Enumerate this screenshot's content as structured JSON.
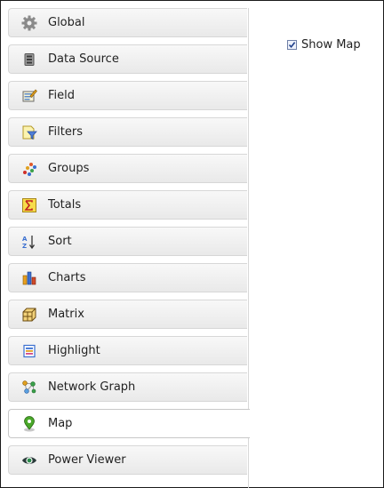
{
  "nav": {
    "items": [
      {
        "label": "Global",
        "icon": "gear-icon"
      },
      {
        "label": "Data Source",
        "icon": "database-icon"
      },
      {
        "label": "Field",
        "icon": "field-edit-icon"
      },
      {
        "label": "Filters",
        "icon": "filter-icon"
      },
      {
        "label": "Groups",
        "icon": "groups-icon"
      },
      {
        "label": "Totals",
        "icon": "sigma-icon"
      },
      {
        "label": "Sort",
        "icon": "sort-az-icon"
      },
      {
        "label": "Charts",
        "icon": "bar-chart-icon"
      },
      {
        "label": "Matrix",
        "icon": "matrix-icon"
      },
      {
        "label": "Highlight",
        "icon": "highlight-icon"
      },
      {
        "label": "Network Graph",
        "icon": "network-graph-icon"
      },
      {
        "label": "Map",
        "icon": "map-pin-icon",
        "active": true
      },
      {
        "label": "Power Viewer",
        "icon": "eye-icon"
      }
    ]
  },
  "options": {
    "show_map_label": "Show Map",
    "show_map_checked": true
  }
}
